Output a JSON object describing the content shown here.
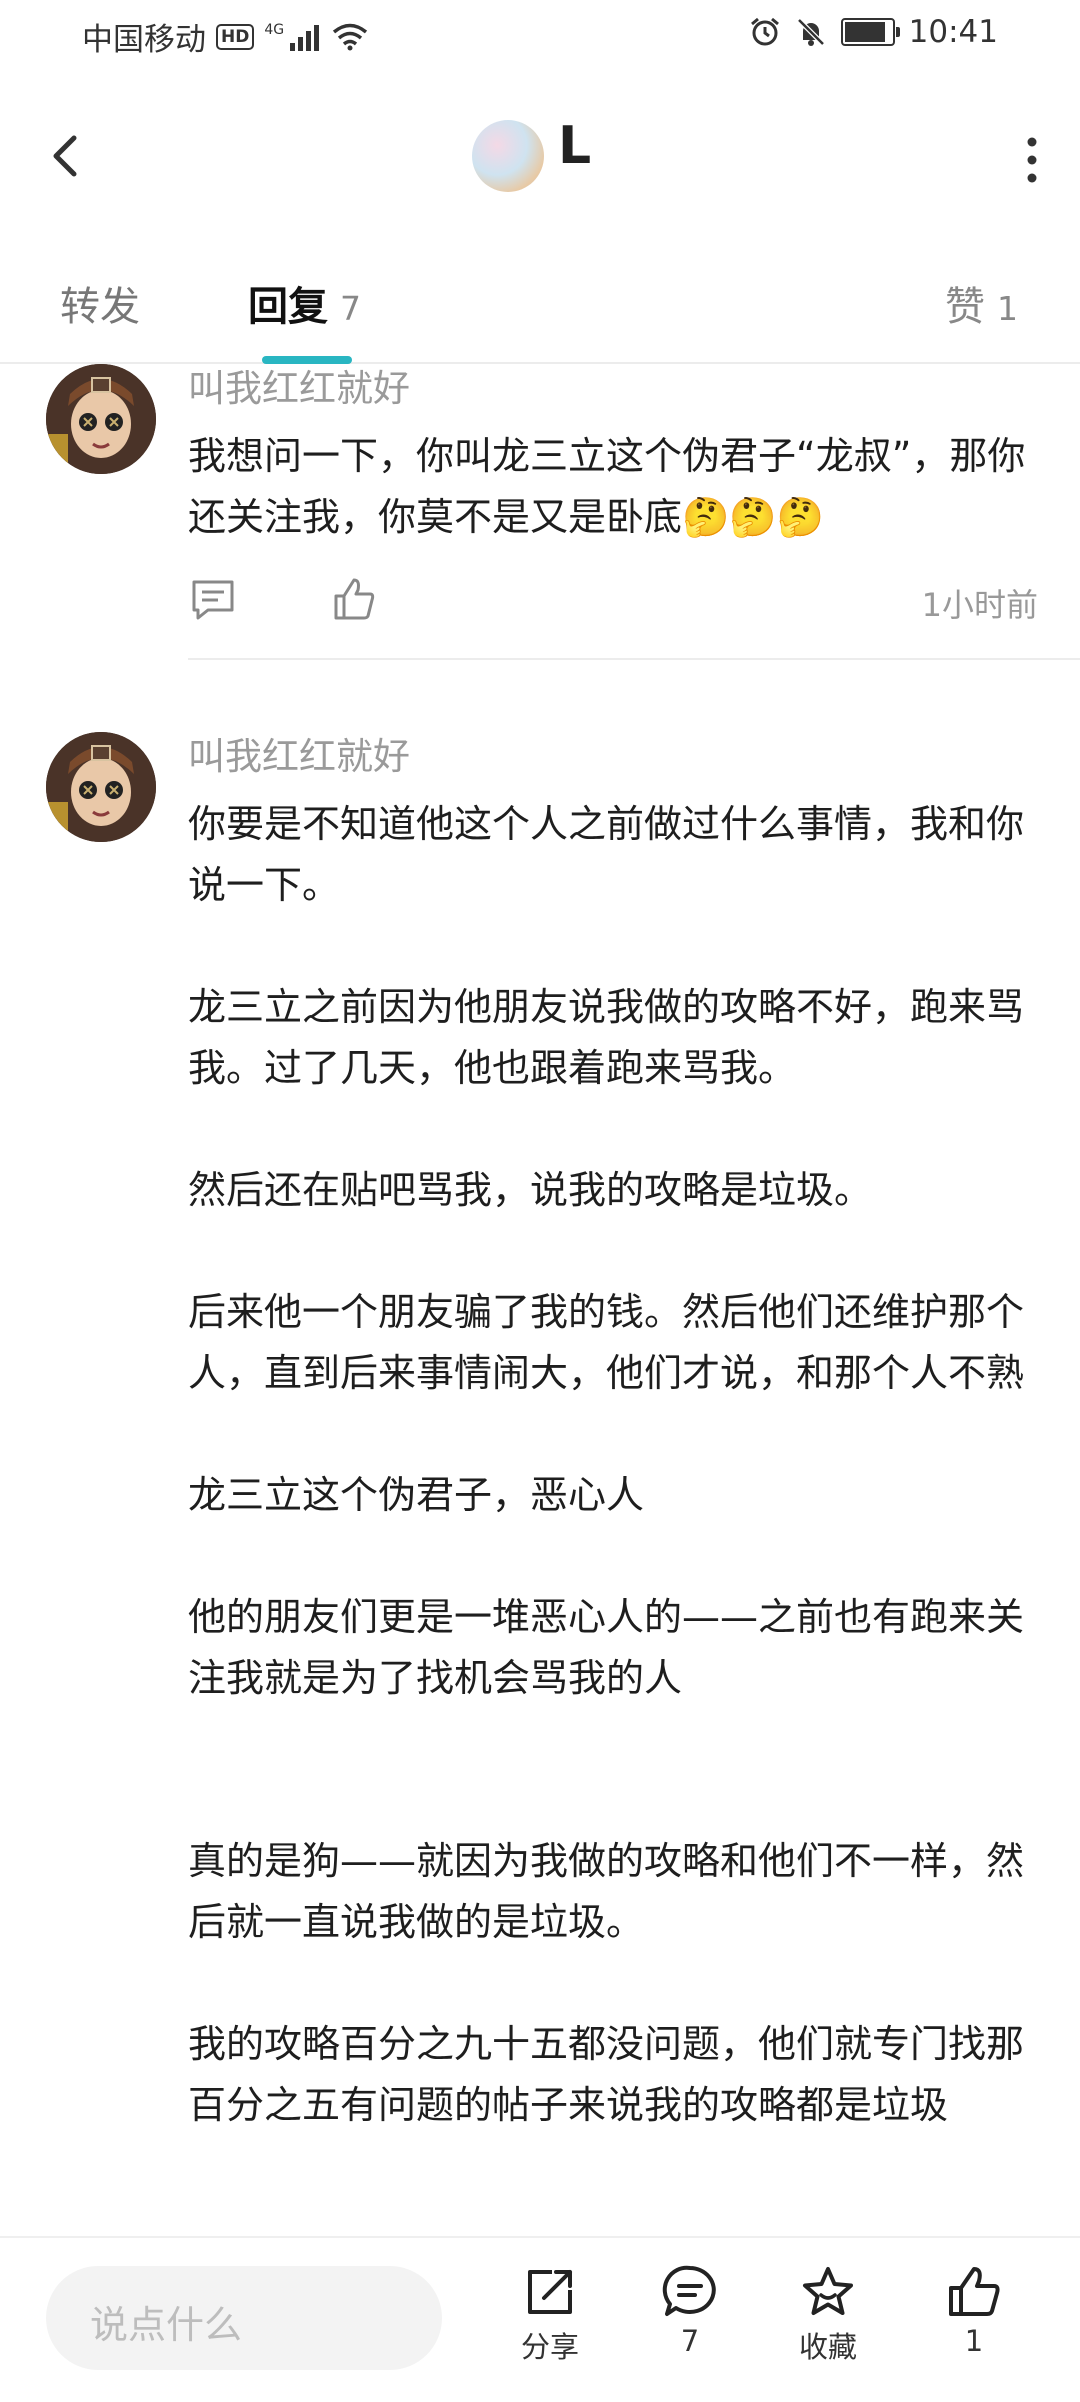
{
  "status_bar": {
    "carrier": "中国移动",
    "hd": "HD",
    "network": "4G",
    "time": "10:41"
  },
  "header": {
    "title": "L",
    "icons": {
      "back": "back-arrow-icon",
      "more": "more-vertical-icon"
    }
  },
  "tabs": {
    "forward": "转发",
    "reply": "回复",
    "reply_count": "7",
    "like": "赞",
    "like_count": "1",
    "accent": "#29b6c2"
  },
  "comments": [
    {
      "author": "叫我红红就好",
      "text": "我想问一下，你叫龙三立这个伪君子“龙叔”，那你还关注我，你莫不是又是卧底🤔🤔🤔",
      "time": "1小时前"
    },
    {
      "author": "叫我红红就好",
      "text": "你要是不知道他这个人之前做过什么事情，我和你说一下。\n\n龙三立之前因为他朋友说我做的攻略不好，跑来骂我。过了几天，他也跟着跑来骂我。\n\n然后还在贴吧骂我，说我的攻略是垃圾。\n\n后来他一个朋友骗了我的钱。然后他们还维护那个人，直到后来事情闹大，他们才说，和那个人不熟\n\n龙三立这个伪君子，恶心人\n\n他的朋友们更是一堆恶心人的——之前也有跑来关注我就是为了找机会骂我的人\n\n\n真的是狗——就因为我做的攻略和他们不一样，然后就一直说我做的是垃圾。\n\n我的攻略百分之九十五都没问题，他们就专门找那百分之五有问题的帖子来说我的攻略都是垃圾"
    }
  ],
  "bottom_bar": {
    "input_placeholder": "说点什么",
    "share_label": "分享",
    "comment_count": "7",
    "favorite_label": "收藏",
    "like_count": "1"
  }
}
